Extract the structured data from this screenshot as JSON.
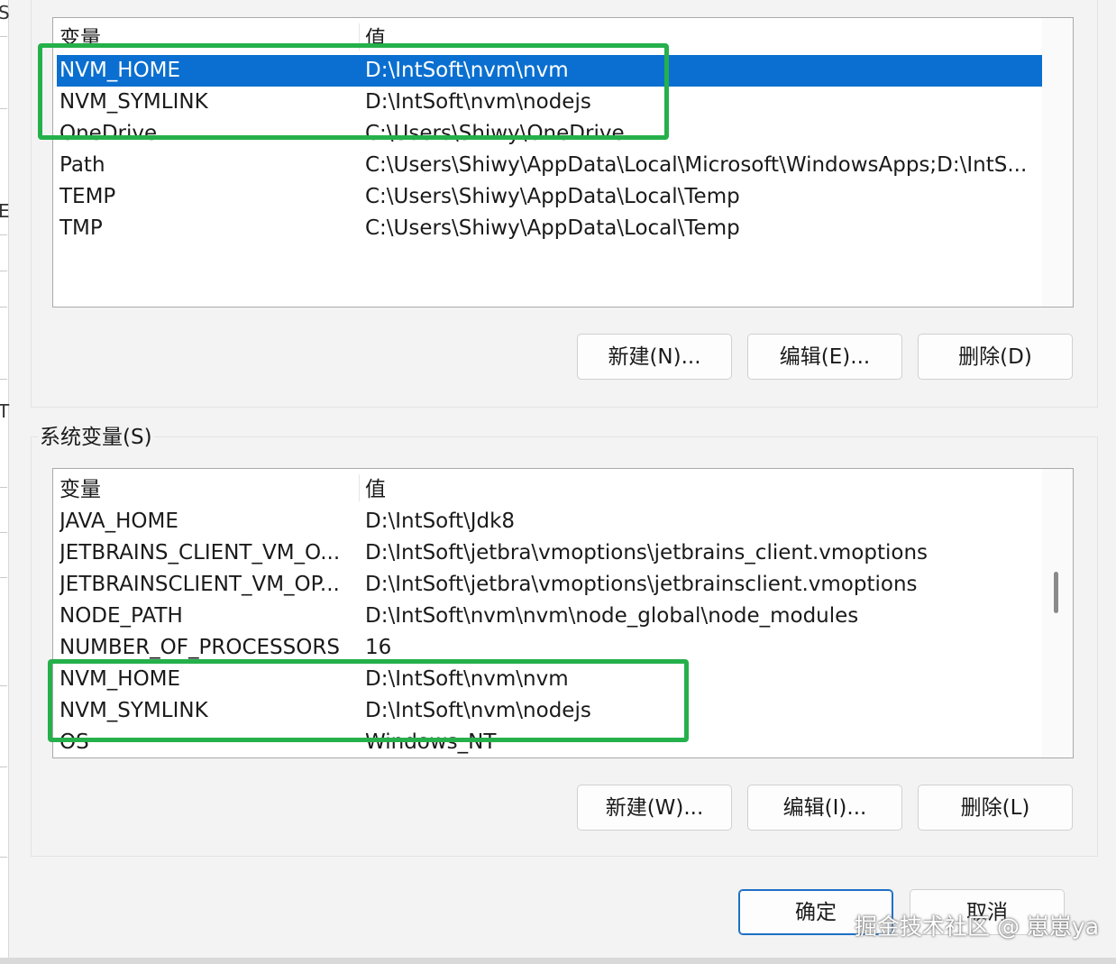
{
  "colors": {
    "selection": "#0a6fd0",
    "highlight": "#25b04b",
    "primary_border": "#1f6fc5"
  },
  "left_strip": {
    "marks": [
      "S",
      "E",
      "T"
    ]
  },
  "user_vars": {
    "columns": {
      "name": "变量",
      "value": "值"
    },
    "rows": [
      {
        "name": "NVM_HOME",
        "value": "D:\\IntSoft\\nvm\\nvm",
        "selected": true
      },
      {
        "name": "NVM_SYMLINK",
        "value": "D:\\IntSoft\\nvm\\nodejs",
        "selected": false
      },
      {
        "name": "OneDrive",
        "value": "C:\\Users\\Shiwy\\OneDrive",
        "selected": false
      },
      {
        "name": "Path",
        "value": "C:\\Users\\Shiwy\\AppData\\Local\\Microsoft\\WindowsApps;D:\\IntS...",
        "selected": false
      },
      {
        "name": "TEMP",
        "value": "C:\\Users\\Shiwy\\AppData\\Local\\Temp",
        "selected": false
      },
      {
        "name": "TMP",
        "value": "C:\\Users\\Shiwy\\AppData\\Local\\Temp",
        "selected": false
      }
    ],
    "buttons": {
      "new": "新建(N)...",
      "edit": "编辑(E)...",
      "delete": "删除(D)"
    }
  },
  "system_vars": {
    "title": "系统变量(S)",
    "columns": {
      "name": "变量",
      "value": "值"
    },
    "rows": [
      {
        "name": "JAVA_HOME",
        "value": "D:\\IntSoft\\Jdk8"
      },
      {
        "name": "JETBRAINS_CLIENT_VM_O...",
        "value": "D:\\IntSoft\\jetbra\\vmoptions\\jetbrains_client.vmoptions"
      },
      {
        "name": "JETBRAINSCLIENT_VM_OP...",
        "value": "D:\\IntSoft\\jetbra\\vmoptions\\jetbrainsclient.vmoptions"
      },
      {
        "name": "NODE_PATH",
        "value": "D:\\IntSoft\\nvm\\nvm\\node_global\\node_modules"
      },
      {
        "name": "NUMBER_OF_PROCESSORS",
        "value": "16"
      },
      {
        "name": "NVM_HOME",
        "value": "D:\\IntSoft\\nvm\\nvm"
      },
      {
        "name": "NVM_SYMLINK",
        "value": "D:\\IntSoft\\nvm\\nodejs"
      },
      {
        "name": "OS",
        "value": "Windows_NT"
      }
    ],
    "buttons": {
      "new": "新建(W)...",
      "edit": "编辑(I)...",
      "delete": "删除(L)"
    }
  },
  "dialog_buttons": {
    "ok": "确定",
    "cancel": "取消"
  },
  "watermark": "掘金技术社区 @ 崽崽ya"
}
